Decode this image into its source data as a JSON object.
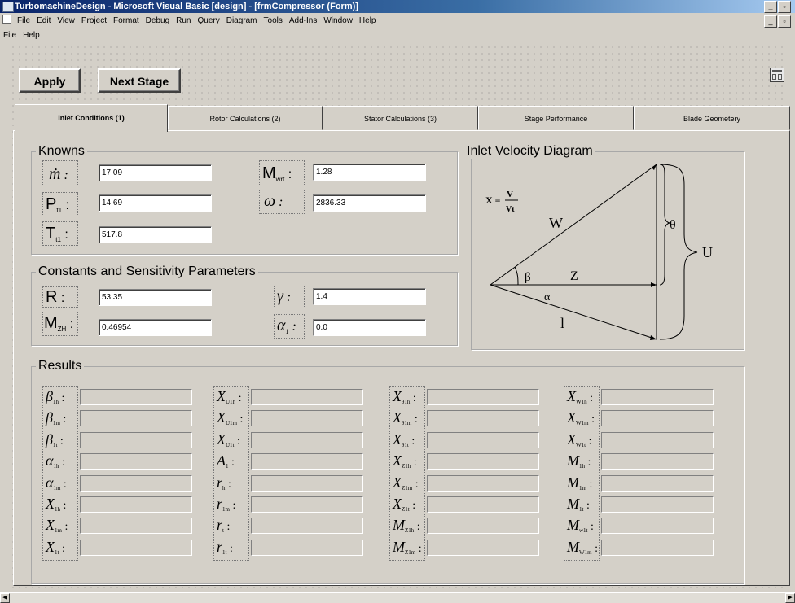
{
  "window": {
    "title": "TurbomachineDesign - Microsoft Visual Basic [design] - [frmCompressor (Form)]",
    "controls": [
      "_",
      "%",
      "×"
    ]
  },
  "ide_menu": [
    "File",
    "Edit",
    "View",
    "Project",
    "Format",
    "Debug",
    "Run",
    "Query",
    "Diagram",
    "Tools",
    "Add-Ins",
    "Window",
    "Help"
  ],
  "form_menu": [
    "File",
    "Help"
  ],
  "toolbar": {
    "apply_label": "Apply",
    "next_stage_label": "Next Stage"
  },
  "tabs": [
    {
      "label": "Inlet Conditions (1)",
      "active": true
    },
    {
      "label": "Rotor Calculations (2)",
      "active": false
    },
    {
      "label": "Stator Calculations (3)",
      "active": false
    },
    {
      "label": "Stage Performance",
      "active": false
    },
    {
      "label": "Blade Geometery",
      "active": false
    }
  ],
  "knowns": {
    "title": "Knowns",
    "m_dot": "17.09",
    "p_t1": "14.69",
    "t_t1": "517.8",
    "m_wrel": "1.28",
    "omega": "2836.33"
  },
  "constants": {
    "title": "Constants and Sensitivity Parameters",
    "r": "53.35",
    "gamma": "1.4",
    "m_zh": "0.46954",
    "alpha_1": "0.0"
  },
  "diagram": {
    "title": "Inlet Velocity Diagram",
    "formula_x": "X =",
    "formula_num": "V",
    "formula_den": "Vt",
    "label_w": "W",
    "label_theta": "θ",
    "label_u": "U",
    "label_beta": "β",
    "label_z": "Z",
    "label_alpha": "α",
    "label_one": "l"
  },
  "results": {
    "title": "Results",
    "columns": [
      [
        {
          "sym": "β",
          "sub": "1h"
        },
        {
          "sym": "β",
          "sub": "1m"
        },
        {
          "sym": "β",
          "sub": "1t"
        },
        {
          "sym": "α",
          "sub": "1h"
        },
        {
          "sym": "α",
          "sub": "1m"
        },
        {
          "sym": "X",
          "sub": "1h"
        },
        {
          "sym": "X",
          "sub": "1m"
        },
        {
          "sym": "X",
          "sub": "1t"
        }
      ],
      [
        {
          "sym": "X",
          "sub": "U1h"
        },
        {
          "sym": "X",
          "sub": "U1m"
        },
        {
          "sym": "X",
          "sub": "U1t"
        },
        {
          "sym": "A",
          "sub": "1"
        },
        {
          "sym": "r",
          "sub": "h"
        },
        {
          "sym": "r",
          "sub": "1m"
        },
        {
          "sym": "r",
          "sub": "t"
        },
        {
          "sym": "r",
          "sub": "1t"
        }
      ],
      [
        {
          "sym": "X",
          "sub": "θ1h"
        },
        {
          "sym": "X",
          "sub": "θ1m"
        },
        {
          "sym": "X",
          "sub": "θ1t"
        },
        {
          "sym": "X",
          "sub": "Z1h"
        },
        {
          "sym": "X",
          "sub": "Z1m"
        },
        {
          "sym": "X",
          "sub": "Z1t"
        },
        {
          "sym": "M",
          "sub": "Z1h"
        },
        {
          "sym": "M",
          "sub": "Z1m"
        }
      ],
      [
        {
          "sym": "X",
          "sub": "W1h"
        },
        {
          "sym": "X",
          "sub": "W1m"
        },
        {
          "sym": "X",
          "sub": "W1t"
        },
        {
          "sym": "M",
          "sub": "1h"
        },
        {
          "sym": "M",
          "sub": "1m"
        },
        {
          "sym": "M",
          "sub": "1t"
        },
        {
          "sym": "M",
          "sub": "w1t"
        },
        {
          "sym": "M",
          "sub": "W1m"
        }
      ]
    ]
  }
}
